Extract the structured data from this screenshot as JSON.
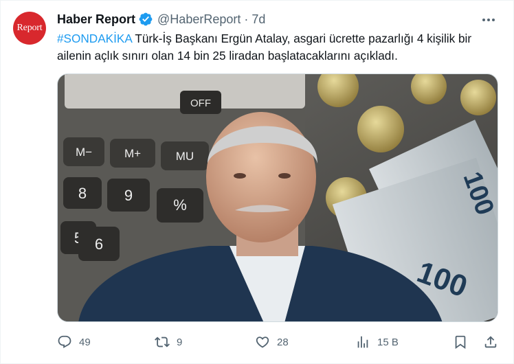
{
  "account": {
    "avatar_text": "Report",
    "name": "Haber Report",
    "handle": "@HaberReport",
    "separator": "·",
    "time": "7d"
  },
  "tweet": {
    "hashtag": "#SONDAKİKA",
    "body": " Türk-İş Başkanı Ergün Atalay, asgari ücrette pazarlığı 4 kişilik bir ailenin açlık sınırı olan 14 bin 25 liradan başlatacaklarını açıkladı."
  },
  "media": {
    "calc_keys": [
      "M−",
      "M+",
      "MU",
      "8",
      "9",
      "%",
      "5",
      "6",
      "OFF"
    ],
    "banknote_label": "100"
  },
  "actions": {
    "reply_count": "49",
    "retweet_count": "9",
    "like_count": "28",
    "views_count": "15 B"
  },
  "colors": {
    "accent": "#1d9bf0",
    "muted": "#536471",
    "avatar_bg": "#d8282d"
  },
  "icons": [
    "verified-badge-icon",
    "more-icon",
    "reply-icon",
    "retweet-icon",
    "like-icon",
    "views-icon",
    "bookmark-icon",
    "share-icon"
  ]
}
